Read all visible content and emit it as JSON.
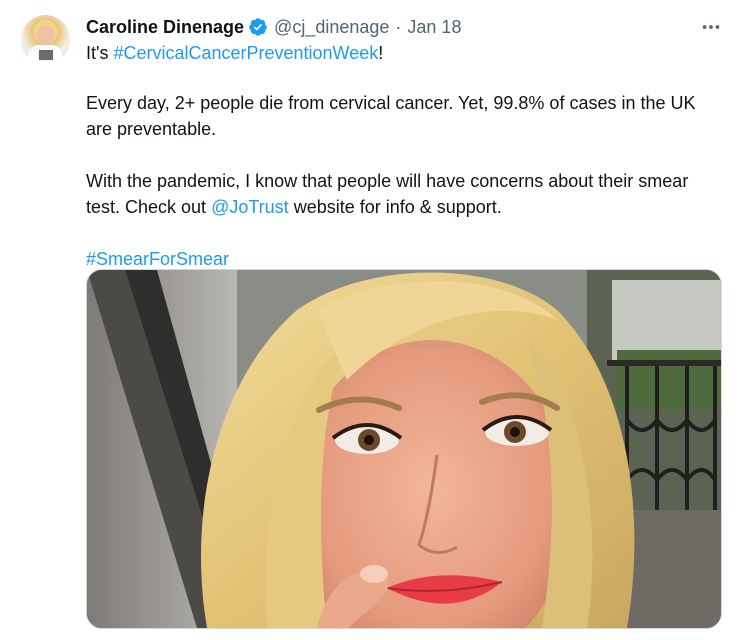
{
  "tweet": {
    "author_name": "Caroline Dinenage",
    "handle": "@cj_dinenage",
    "separator": "·",
    "date": "Jan 18",
    "line1_prefix": "It's ",
    "line1_hashtag": "#CervicalCancerPreventionWeek",
    "line1_suffix": "!",
    "para2": "Every day, 2+ people die from cervical cancer. Yet, 99.8% of cases in the UK are preventable.",
    "para3_prefix": "With the pandemic, I know that people will have concerns about their smear test. Check out ",
    "para3_mention": "@JoTrust",
    "para3_suffix": " website for info & support.",
    "hashtag2": "#SmearForSmear"
  },
  "icons": {
    "verified": "verified-badge-icon",
    "more": "more-options-icon"
  },
  "colors": {
    "link": "#1d9bf0",
    "secondary_text": "#536471",
    "primary_text": "#0f1419",
    "verified": "#1d9bf0"
  }
}
